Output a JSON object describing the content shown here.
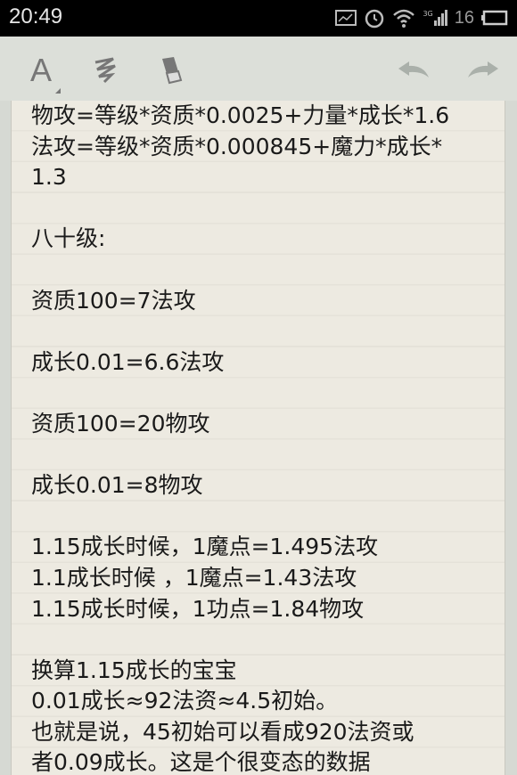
{
  "status_bar": {
    "time": "20:49",
    "network": "3G",
    "battery": "16"
  },
  "toolbar": {
    "icons": [
      "text-format-icon",
      "handwriting-icon",
      "eraser-icon",
      "undo-icon",
      "redo-icon"
    ]
  },
  "note": {
    "lines": [
      "物攻=等级*资质*0.0025+力量*成长*1.6",
      "法攻=等级*资质*0.000845+魔力*成长*",
      "1.3",
      "",
      "八十级:",
      "",
      "资质100=7法攻",
      "",
      "成长0.01=6.6法攻",
      "",
      "资质100=20物攻",
      "",
      "成长0.01=8物攻",
      "",
      "1.15成长时候，1魔点=1.495法攻",
      "1.1成长时候  ，1魔点=1.43法攻",
      "1.15成长时候，1功点=1.84物攻",
      "",
      "换算1.15成长的宝宝",
      "0.01成长≈92法资≈4.5初始。",
      "也就是说，45初始可以看成920法资或",
      "者0.09成长。这是个很变态的数据"
    ]
  }
}
